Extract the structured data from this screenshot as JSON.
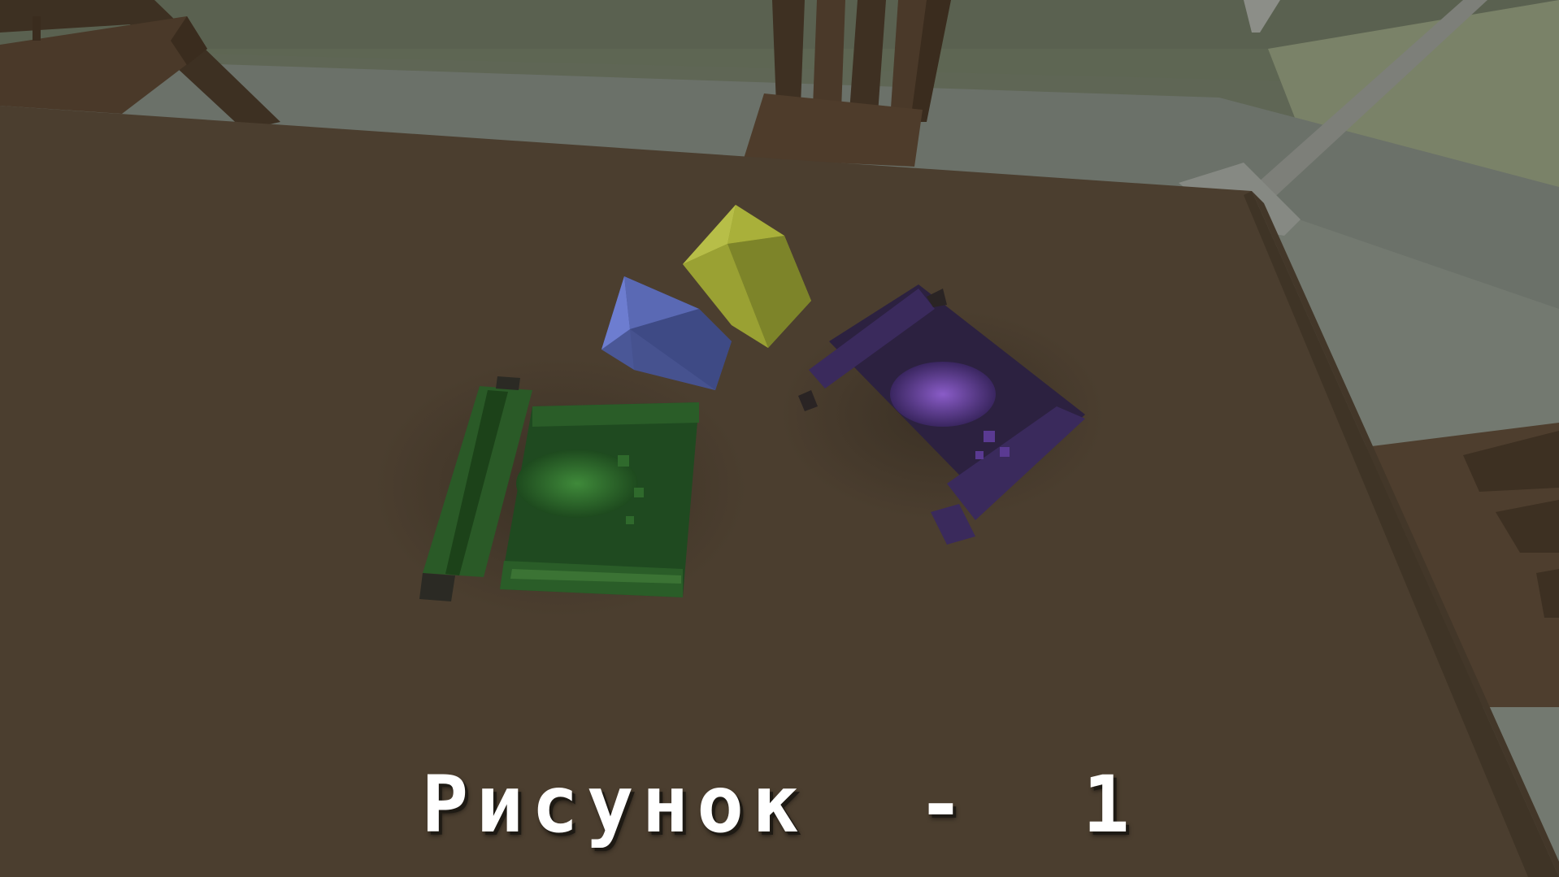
{
  "caption": "Рисунок  -  1",
  "items": {
    "blue_crystal": "blue-crystal",
    "yellow_crystal": "yellow-crystal",
    "green_scroll": "green-scroll",
    "purple_scroll": "purple-scroll"
  },
  "colors": {
    "table": "#4b3e2f",
    "wall": "#5e6653",
    "floor": "#6c726a",
    "chair": "#4a3929",
    "blue_crystal": "#5a69b4",
    "yellow_crystal": "#a9b03a",
    "green_scroll": "#1f4a20",
    "purple_scroll": "#2c2140",
    "caption_text": "#ffffff"
  }
}
